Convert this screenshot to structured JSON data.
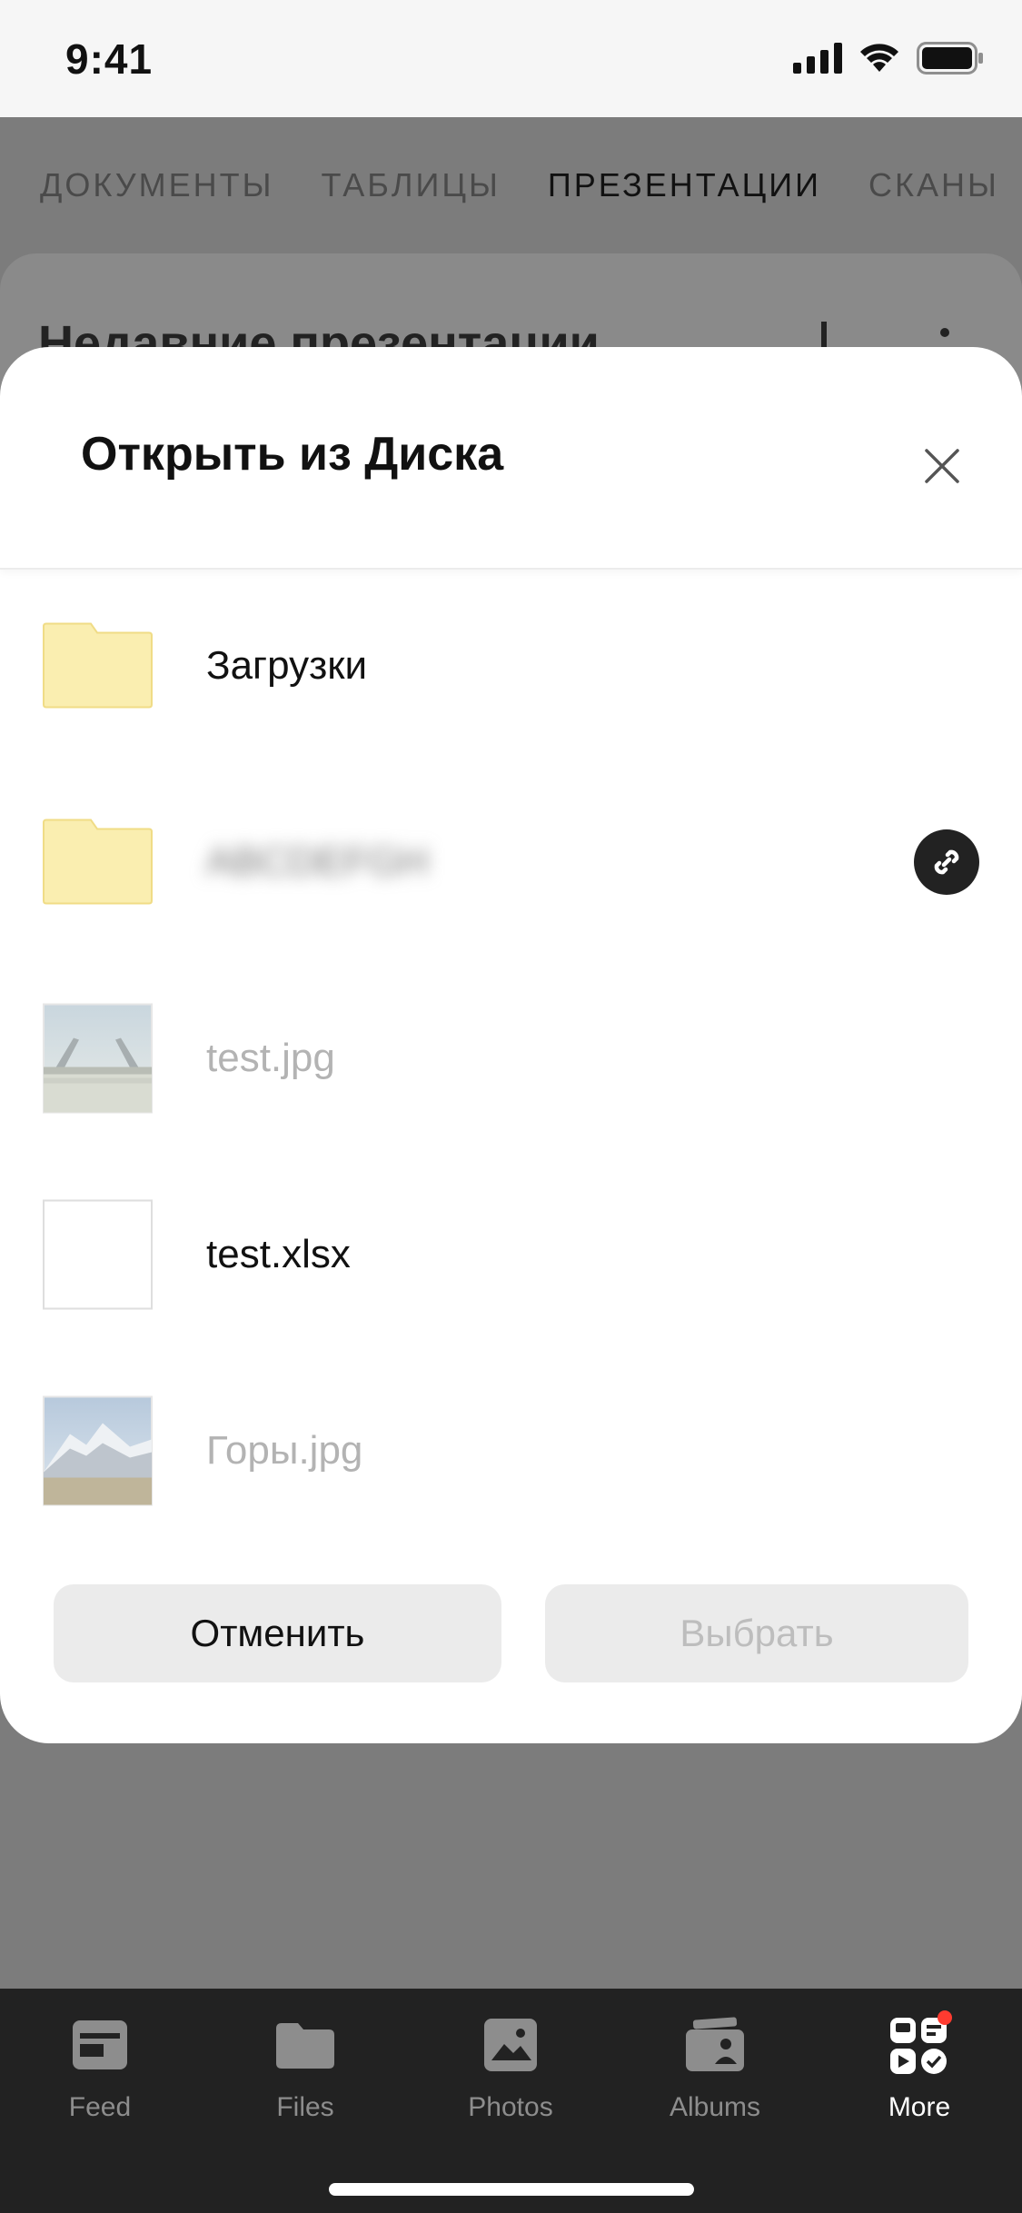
{
  "status_bar": {
    "time": "9:41"
  },
  "background": {
    "tabs": [
      {
        "label": "ДОКУМЕНТЫ",
        "active": false
      },
      {
        "label": "ТАБЛИЦЫ",
        "active": false
      },
      {
        "label": "ПРЕЗЕНТАЦИИ",
        "active": true
      },
      {
        "label": "СКАНЫ",
        "active": false
      }
    ],
    "card_title": "Недавние презентации"
  },
  "sheet": {
    "title": "Открыть из Диска",
    "items": [
      {
        "name": "Загрузки",
        "type": "folder",
        "enabled": true
      },
      {
        "name": "ABCDEFGH",
        "type": "folder",
        "enabled": true,
        "shared": true,
        "blurred": true
      },
      {
        "name": "test.jpg",
        "type": "image",
        "enabled": false
      },
      {
        "name": "test.xlsx",
        "type": "spreadsheet",
        "enabled": true
      },
      {
        "name": "Горы.jpg",
        "type": "image",
        "enabled": false
      }
    ],
    "cancel_label": "Отменить",
    "select_label": "Выбрать"
  },
  "tabbar": {
    "items": [
      {
        "label": "Feed",
        "icon": "feed-icon"
      },
      {
        "label": "Files",
        "icon": "folder-icon"
      },
      {
        "label": "Photos",
        "icon": "photo-icon"
      },
      {
        "label": "Albums",
        "icon": "albums-icon"
      },
      {
        "label": "More",
        "icon": "more-grid-icon",
        "active": true,
        "badge": true
      }
    ]
  },
  "colors": {
    "folder_fill": "#faeeb0",
    "folder_stroke": "#f0dc86",
    "badge_red": "#ff3b30",
    "tabbar_bg": "#222222"
  }
}
